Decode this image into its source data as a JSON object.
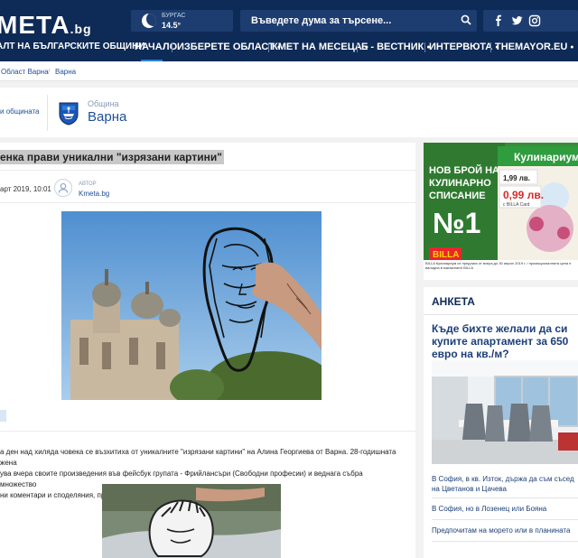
{
  "header": {
    "logo_main": "МЕТА",
    "logo_tld": ".bg",
    "logo_sub": "АЛТ НА БЪЛГАРСКИТЕ ОБЩИНИ",
    "weather_city": "БУРГАС",
    "weather_temp": "14.5°",
    "search_placeholder": "Въведете дума за търсене...",
    "social": [
      "f",
      "t",
      "ig"
    ],
    "nav": [
      "НАЧАЛО",
      "ИЗБЕРЕТЕ ОБЛАСТ",
      "КМЕТ НА МЕСЕЦА",
      "Е - ВЕСТНИК",
      "ИНТЕРВЮТА",
      "THEMAYOR.EU"
    ]
  },
  "breadcrumb": [
    "Област Варна",
    "Варна"
  ],
  "municipality": {
    "left_link": "и общината",
    "label": "Община",
    "name": "Варна"
  },
  "article": {
    "title": "енка прави уникални \"изрязани картини\"",
    "date": "арт 2019, 10:01",
    "author_label": "АВТОР",
    "author": "Kmeta.bg",
    "text_lines": [
      "а ден над хиляда човека се възхитиха от уникалните \"изрязани картини\" на Алина Георгиева от Варна. 28-годишната жена",
      "ува вчера своите произведения във фейсбук групата - Фрийлансъри (Свободни професии) и веднага събра множество",
      "ни коментари и споделяния, превръщайки се в истински хит."
    ]
  },
  "ad": {
    "line1": "НОВ БРОЙ НА",
    "line2": "КУЛИНАРНО",
    "line3": "СПИСАНИЕ",
    "big": "№1",
    "magazine": "Кулинариум",
    "price_old": "1,99 лв.",
    "price_new": "0,99 лв.",
    "price_note": "с BILLA Card",
    "brand": "BILLA",
    "disclaimer": "BILLA Кулинариум се предлага от вчера до 30 април 2019 г. / промоционалната цена е валидна в магазините BILLA"
  },
  "poll": {
    "title": "АНКЕТА",
    "question": "Къде бихте желали да си купите апартамент за 650 евро на кв./м?",
    "options": [
      "В София, в кв. Изток, държа да съм съсед на Цветанов и Цачева",
      "В София, но в Лозенец или Бояна",
      "Предпочитам на морето или в планината"
    ]
  }
}
